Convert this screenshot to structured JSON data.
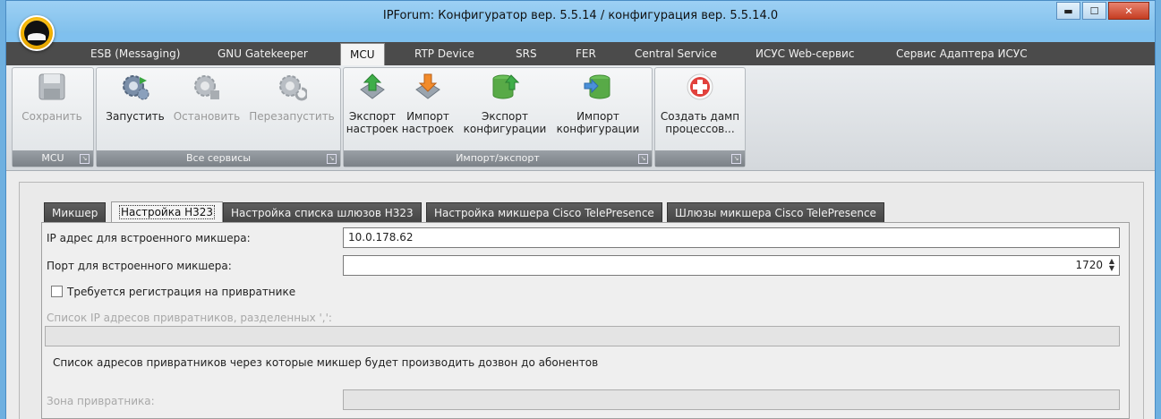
{
  "window": {
    "title": "IPForum: Конфигуратор вер. 5.5.14 / конфигурация вер. 5.5.14.0",
    "icons": {
      "minimize": "minimize-icon",
      "maximize": "maximize-icon",
      "close": "close-icon"
    }
  },
  "tabs": [
    {
      "label": "ESB (Messaging)"
    },
    {
      "label": "GNU Gatekeeper"
    },
    {
      "label": "MCU",
      "active": true
    },
    {
      "label": "RTP Device"
    },
    {
      "label": "SRS"
    },
    {
      "label": "FER"
    },
    {
      "label": "Central Service"
    },
    {
      "label": "ИСУС Web-сервис"
    },
    {
      "label": "Сервис Адаптера ИСУС"
    }
  ],
  "ribbon": {
    "groups": [
      {
        "label": "MCU"
      },
      {
        "label": "Все сервисы"
      },
      {
        "label": "Импорт/экспорт"
      },
      {
        "label": ""
      }
    ],
    "buttons": {
      "save": {
        "line1": "Сохранить",
        "line2": "",
        "icon": "floppy-disk-icon",
        "enabled": false
      },
      "start": {
        "line1": "Запустить",
        "line2": "",
        "icon": "gears-start-icon",
        "enabled": true
      },
      "stop": {
        "line1": "Остановить",
        "line2": "",
        "icon": "gears-stop-icon",
        "enabled": false
      },
      "restart": {
        "line1": "Перезапустить",
        "line2": "",
        "icon": "gears-restart-icon",
        "enabled": false
      },
      "export_settings": {
        "line1": "Экспорт",
        "line2": "настроек",
        "icon": "export-arrow-icon"
      },
      "import_settings": {
        "line1": "Импорт",
        "line2": "настроек",
        "icon": "import-arrow-icon"
      },
      "export_config": {
        "line1": "Экспорт",
        "line2": "конфигурации",
        "icon": "export-db-icon"
      },
      "import_config": {
        "line1": "Импорт",
        "line2": "конфигурации",
        "icon": "import-db-icon"
      },
      "dump": {
        "line1": "Создать дамп",
        "line2": "процессов...",
        "icon": "medical-cross-icon"
      }
    }
  },
  "subtabs": [
    {
      "label": "Микшер"
    },
    {
      "label": "Настройка H323",
      "active": true
    },
    {
      "label": "Настройка списка шлюзов H323"
    },
    {
      "label": "Настройка микшера Cisco TelePresence"
    },
    {
      "label": "Шлюзы микшера Cisco TelePresence"
    }
  ],
  "form": {
    "ip_label": "IP адрес для встроенного микшера:",
    "ip_value": "10.0.178.62",
    "port_label": "Порт для встроенного микшера:",
    "port_value": "1720",
    "gk_reg_label": "Требуется регистрация на привратнике",
    "gk_reg_checked": false,
    "gk_list_label": "Список IP адресов привратников, разделенных ',':",
    "gk_list_value": "",
    "gk_hint": "Список адресов привратников через которые микшер будет производить дозвон до абонентов",
    "zone_label": "Зона привратника:",
    "zone_value": ""
  },
  "colors": {
    "titlebar": "#8ec8f0",
    "tabbar": "#4b4b4b",
    "group_label": "#8a9096",
    "accent_green": "#4caf50",
    "accent_orange": "#f08a24",
    "accent_red": "#d9302c"
  }
}
